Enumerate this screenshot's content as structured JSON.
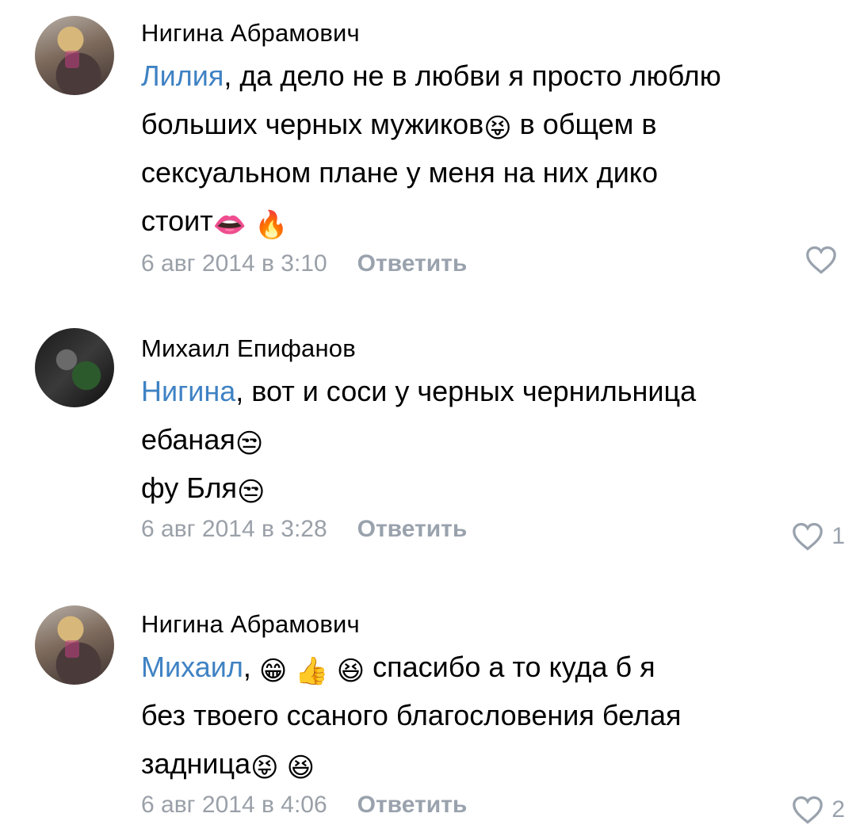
{
  "comments": [
    {
      "author": "Нигина Абрамович",
      "mention": "Лилия",
      "lines": [
        ", да дело не в любви я просто люблю",
        "больших черных мужиков",
        " в общем в",
        "сексуальном плане у меня на них дико",
        "стоит"
      ],
      "emojis": {
        "tongue": "😝",
        "lips": "👄",
        "fire": "🔥"
      },
      "date": "6 авг 2014 в 3:10",
      "reply_label": "Ответить",
      "likes": ""
    },
    {
      "author": "Михаил Епифанов",
      "mention": "Нигина",
      "lines": [
        ", вот и соси у черных чернильница",
        "ебаная",
        "фу Бля"
      ],
      "emojis": {
        "unamused": "😒"
      },
      "date": "6 авг 2014 в 3:28",
      "reply_label": "Ответить",
      "likes": "1"
    },
    {
      "author": "Нигина Абрамович",
      "mention": "Михаил",
      "lines": [
        ",",
        " спасибо а то куда б я",
        "без твоего ссаного благословения белая",
        "задница"
      ],
      "emojis": {
        "grin": "😁",
        "thumbs": "👍",
        "laugh": "😆",
        "tongue": "😝"
      },
      "date": "6 авг 2014 в 4:06",
      "reply_label": "Ответить",
      "likes": "2"
    }
  ],
  "colors": {
    "mention": "#3f82c3",
    "meta": "#9aa0a8",
    "text": "#000000"
  }
}
